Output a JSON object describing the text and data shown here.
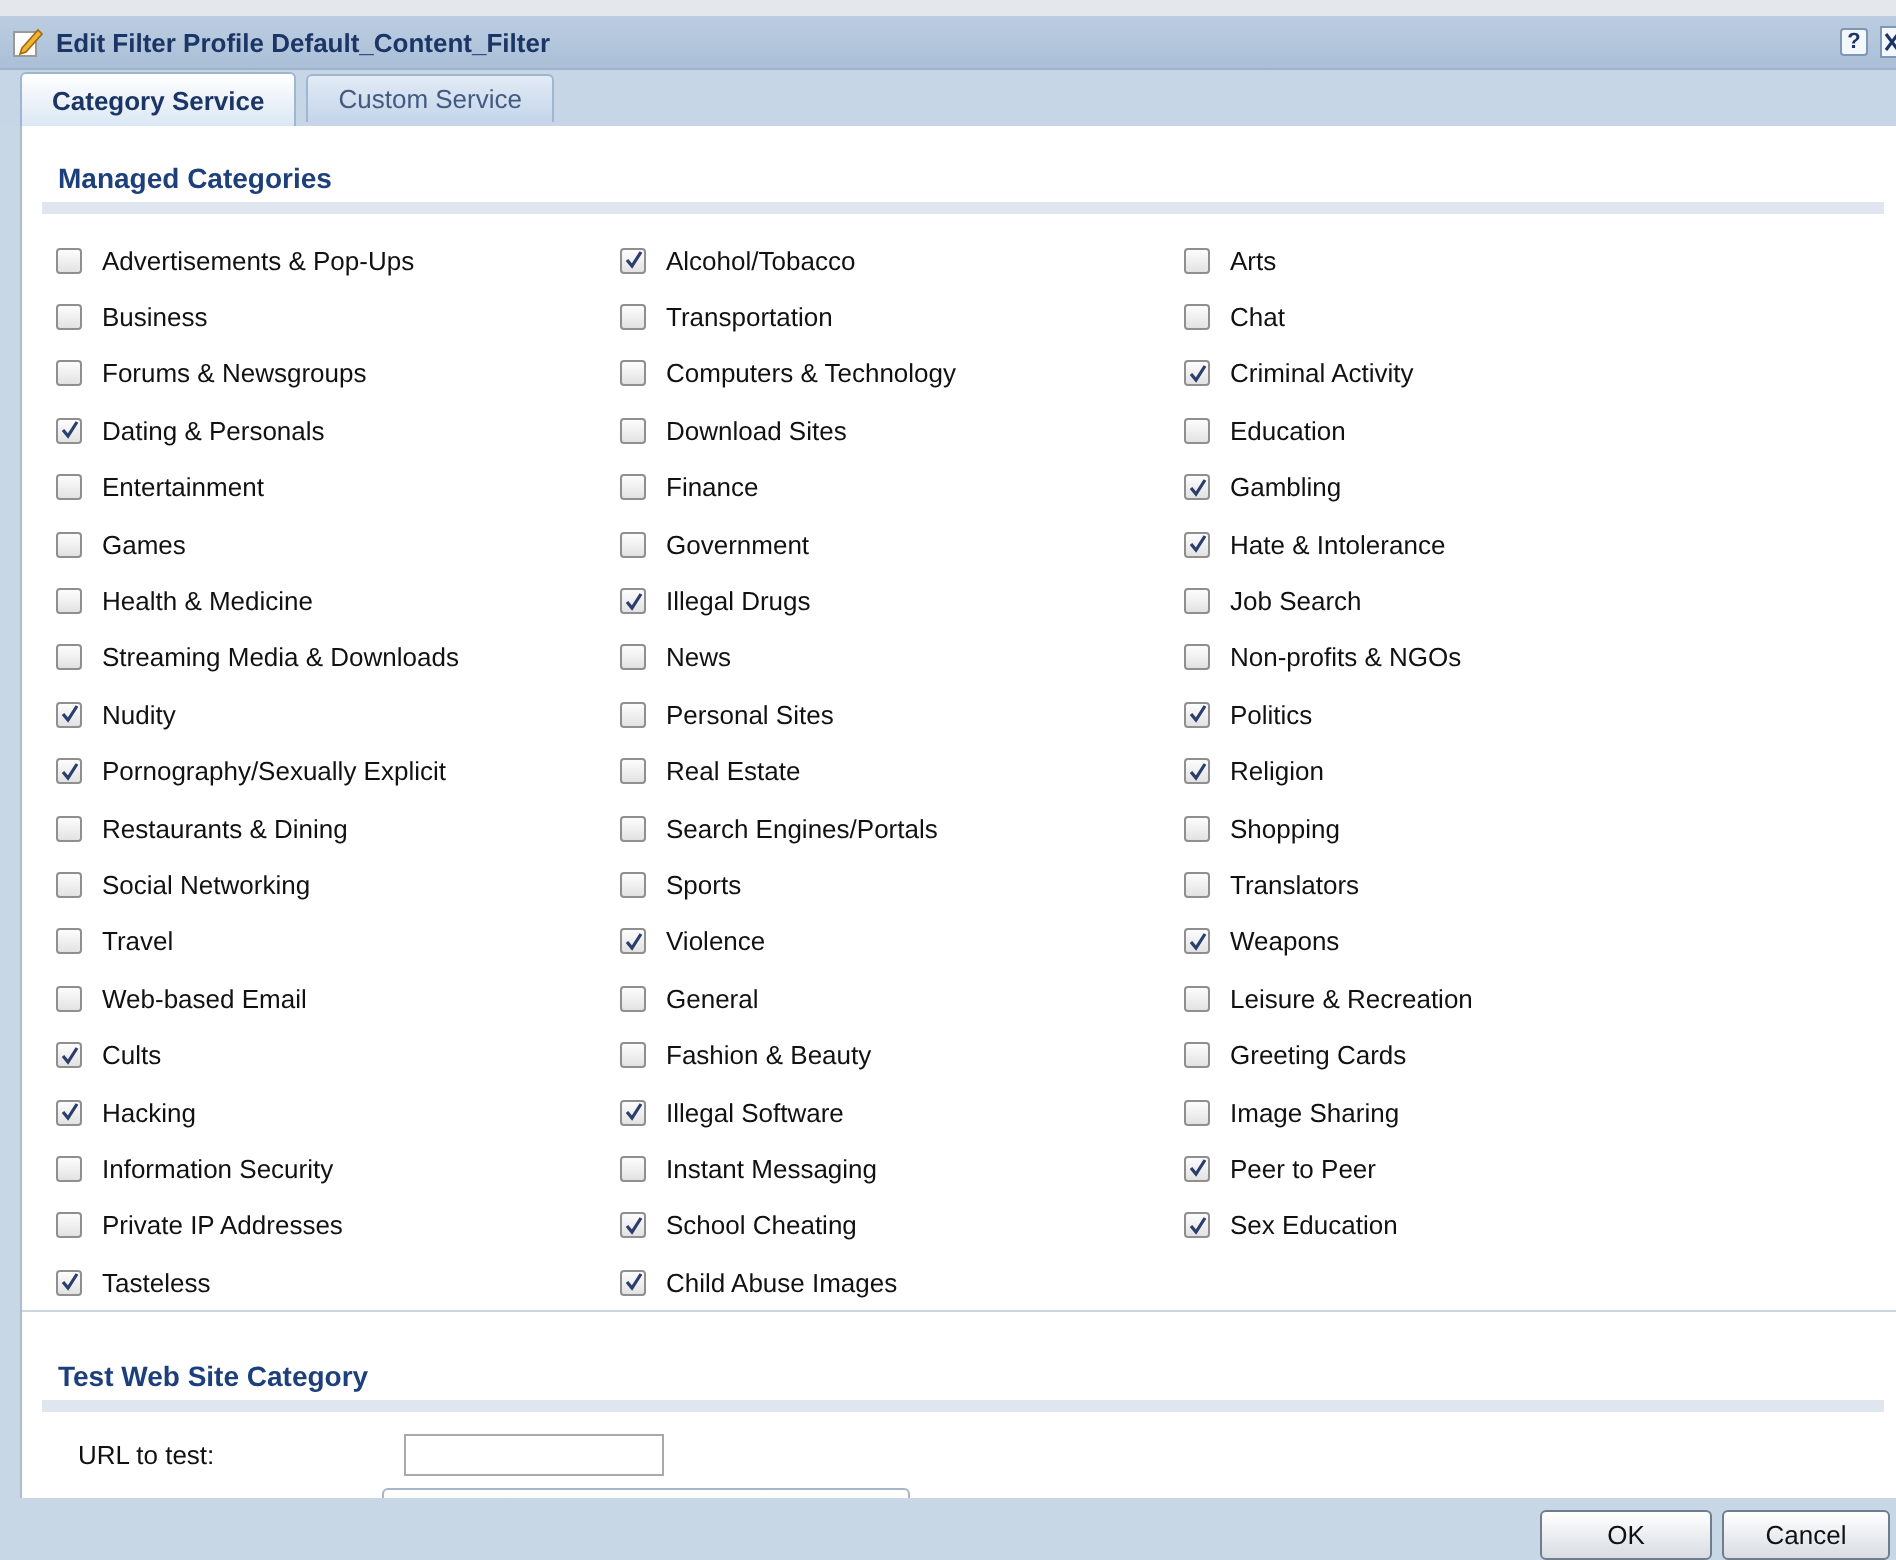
{
  "window": {
    "title": "Edit Filter Profile Default_Content_Filter",
    "help": "?"
  },
  "tabs": [
    {
      "label": "Category Service",
      "selected": true
    },
    {
      "label": "Custom Service",
      "selected": false
    }
  ],
  "managed_categories": {
    "heading": "Managed Categories",
    "items": [
      {
        "label": "Advertisements & Pop-Ups",
        "checked": false
      },
      {
        "label": "Alcohol/Tobacco",
        "checked": true
      },
      {
        "label": "Arts",
        "checked": false
      },
      {
        "label": "Business",
        "checked": false
      },
      {
        "label": "Transportation",
        "checked": false
      },
      {
        "label": "Chat",
        "checked": false
      },
      {
        "label": "Forums & Newsgroups",
        "checked": false
      },
      {
        "label": "Computers & Technology",
        "checked": false
      },
      {
        "label": "Criminal Activity",
        "checked": true
      },
      {
        "label": "Dating & Personals",
        "checked": true
      },
      {
        "label": "Download Sites",
        "checked": false
      },
      {
        "label": "Education",
        "checked": false
      },
      {
        "label": "Entertainment",
        "checked": false
      },
      {
        "label": "Finance",
        "checked": false
      },
      {
        "label": "Gambling",
        "checked": true
      },
      {
        "label": "Games",
        "checked": false
      },
      {
        "label": "Government",
        "checked": false
      },
      {
        "label": "Hate & Intolerance",
        "checked": true
      },
      {
        "label": "Health & Medicine",
        "checked": false
      },
      {
        "label": "Illegal Drugs",
        "checked": true
      },
      {
        "label": "Job Search",
        "checked": false
      },
      {
        "label": "Streaming Media & Downloads",
        "checked": false
      },
      {
        "label": "News",
        "checked": false
      },
      {
        "label": "Non-profits & NGOs",
        "checked": false
      },
      {
        "label": "Nudity",
        "checked": true
      },
      {
        "label": "Personal Sites",
        "checked": false
      },
      {
        "label": "Politics",
        "checked": true
      },
      {
        "label": "Pornography/Sexually Explicit",
        "checked": true
      },
      {
        "label": "Real Estate",
        "checked": false
      },
      {
        "label": "Religion",
        "checked": true
      },
      {
        "label": "Restaurants & Dining",
        "checked": false
      },
      {
        "label": "Search Engines/Portals",
        "checked": false
      },
      {
        "label": "Shopping",
        "checked": false
      },
      {
        "label": "Social Networking",
        "checked": false
      },
      {
        "label": "Sports",
        "checked": false
      },
      {
        "label": "Translators",
        "checked": false
      },
      {
        "label": "Travel",
        "checked": false
      },
      {
        "label": "Violence",
        "checked": true
      },
      {
        "label": "Weapons",
        "checked": true
      },
      {
        "label": "Web-based Email",
        "checked": false
      },
      {
        "label": "General",
        "checked": false
      },
      {
        "label": "Leisure & Recreation",
        "checked": false
      },
      {
        "label": "Cults",
        "checked": true
      },
      {
        "label": "Fashion & Beauty",
        "checked": false
      },
      {
        "label": "Greeting Cards",
        "checked": false
      },
      {
        "label": "Hacking",
        "checked": true
      },
      {
        "label": "Illegal Software",
        "checked": true
      },
      {
        "label": "Image Sharing",
        "checked": false
      },
      {
        "label": "Information Security",
        "checked": false
      },
      {
        "label": "Instant Messaging",
        "checked": false
      },
      {
        "label": "Peer to Peer",
        "checked": true
      },
      {
        "label": "Private IP Addresses",
        "checked": false
      },
      {
        "label": "School Cheating",
        "checked": true
      },
      {
        "label": "Sex Education",
        "checked": true
      },
      {
        "label": "Tasteless",
        "checked": true
      },
      {
        "label": "Child Abuse Images",
        "checked": true
      }
    ]
  },
  "test_web_site_category": {
    "heading": "Test Web Site Category",
    "url_label": "URL to test:"
  },
  "buttons": [
    "OK",
    "Cancel"
  ]
}
